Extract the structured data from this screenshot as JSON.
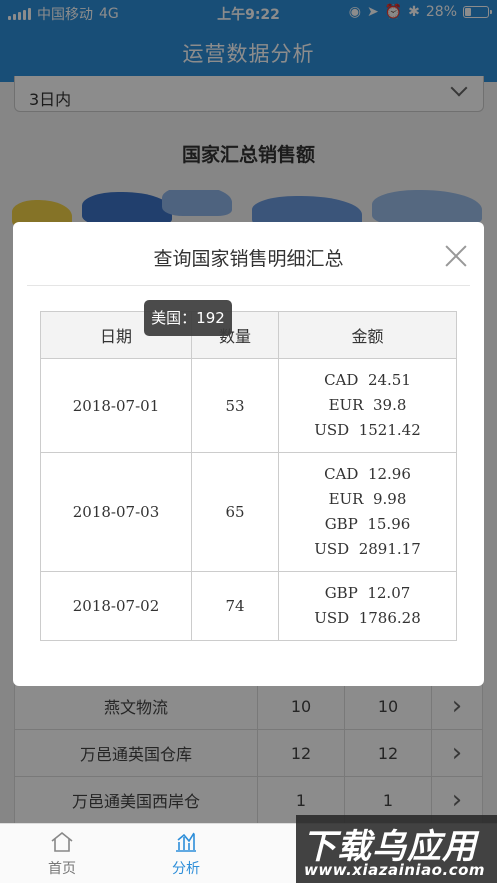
{
  "status_bar": {
    "carrier": "中国移动",
    "network": "4G",
    "time": "上午9:22",
    "battery": "28%",
    "battery_level": 0.28
  },
  "header": {
    "title": "运营数据分析"
  },
  "filter": {
    "range": "3日内"
  },
  "section": {
    "title": "国家汇总销售额"
  },
  "tooltip": {
    "text": "美国：192"
  },
  "modal": {
    "title": "查询国家销售明细汇总",
    "columns": [
      "日期",
      "数量",
      "金额"
    ],
    "rows": [
      {
        "date": "2018-07-01",
        "qty": "53",
        "amounts": [
          "CAD  24.51",
          "EUR  39.8",
          "USD  1521.42"
        ]
      },
      {
        "date": "2018-07-03",
        "qty": "65",
        "amounts": [
          "CAD  12.96",
          "EUR  9.98",
          "GBP  15.96",
          "USD  2891.17"
        ]
      },
      {
        "date": "2018-07-02",
        "qty": "74",
        "amounts": [
          "GBP  12.07",
          "USD  1786.28"
        ]
      }
    ]
  },
  "bg_table": {
    "rows": [
      [
        "燕文物流",
        "10",
        "10"
      ],
      [
        "万邑通英国仓库",
        "12",
        "12"
      ],
      [
        "万邑通美国西岸仓",
        "1",
        "1"
      ]
    ]
  },
  "tabbar": {
    "home": "首页",
    "analysis": "分析"
  },
  "watermark": {
    "big": "下载乌应用",
    "small": "www.xiazainiao.com"
  },
  "colors": {
    "primary": "#2d8ed9"
  }
}
